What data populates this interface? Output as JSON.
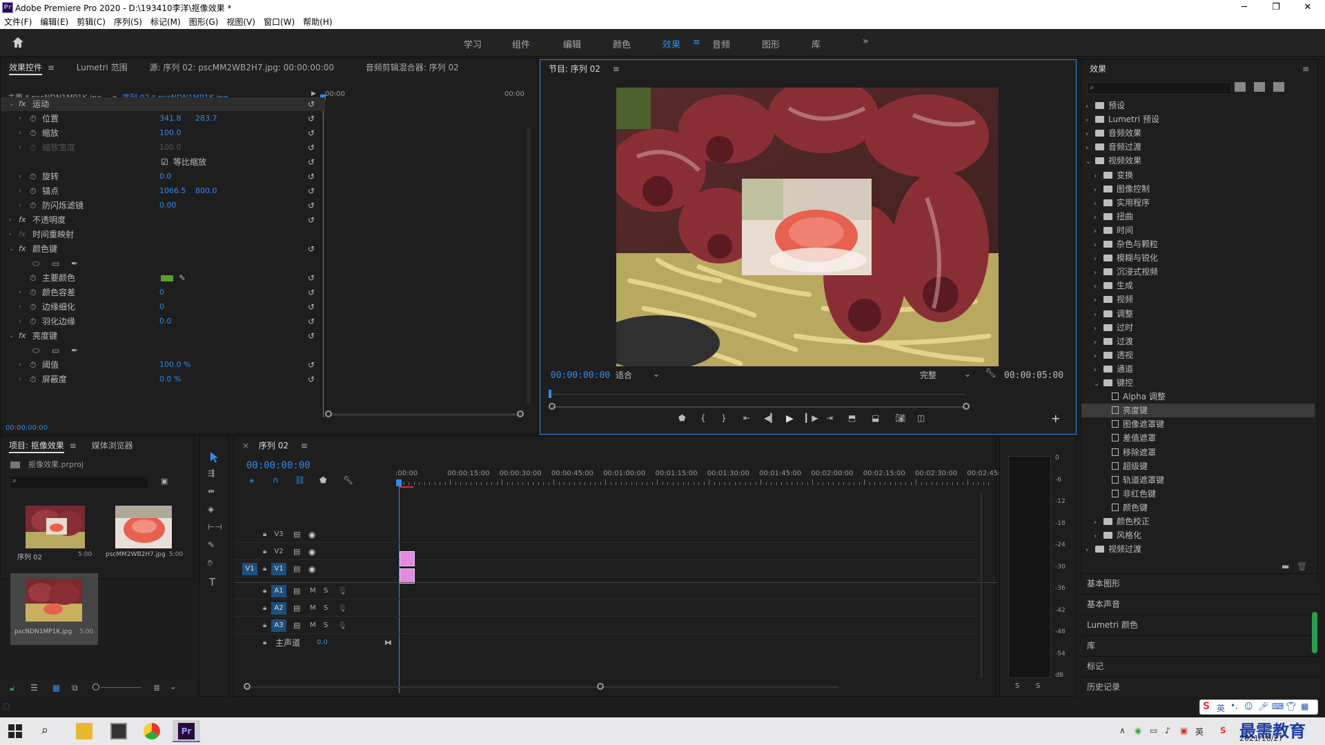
{
  "window": {
    "title": "Adobe Premiere Pro 2020 - D:\\193410李洋\\抠像效果 *",
    "app_icon": "Pr"
  },
  "menu": [
    "文件(F)",
    "编辑(E)",
    "剪辑(C)",
    "序列(S)",
    "标记(M)",
    "图形(G)",
    "视图(V)",
    "窗口(W)",
    "帮助(H)"
  ],
  "workspaces": [
    {
      "label": "学习"
    },
    {
      "label": "组件"
    },
    {
      "label": "编辑"
    },
    {
      "label": "颜色"
    },
    {
      "label": "效果",
      "active": true
    },
    {
      "label": "音频"
    },
    {
      "label": "图形"
    },
    {
      "label": "库"
    }
  ],
  "effect_controls": {
    "tabs": [
      "效果控件",
      "Lumetri 范围",
      "源: 序列 02: pscMM2WB2H7.jpg: 00:00:00:00",
      "音频剪辑混合器: 序列 02"
    ],
    "master": "主要 * pscNDN1MP1K.jpg",
    "sequence_clip": "序列 02 * pscNDN1MP1K.jpg",
    "time_start": "00:00",
    "time_end": "00:00",
    "current_time": "00:00:00:00",
    "rows": [
      {
        "label": "运动",
        "kind": "fx"
      },
      {
        "label": "位置",
        "v1": "341.8",
        "v2": "283.7"
      },
      {
        "label": "缩放",
        "v1": "100.0"
      },
      {
        "label": "缩放宽度",
        "v1": "100.0",
        "dim": true
      },
      {
        "label": "等比缩放",
        "kind": "check"
      },
      {
        "label": "旋转",
        "v1": "0.0"
      },
      {
        "label": "锚点",
        "v1": "1066.5",
        "v2": "800.0"
      },
      {
        "label": "防闪烁滤镜",
        "v1": "0.00"
      },
      {
        "label": "不透明度",
        "kind": "fx"
      },
      {
        "label": "时间重映射",
        "kind": "fx-dim"
      },
      {
        "label": "颜色键",
        "kind": "fx"
      },
      {
        "label": "",
        "kind": "masks"
      },
      {
        "label": "主要颜色",
        "kind": "color"
      },
      {
        "label": "颜色容差",
        "v1": "0"
      },
      {
        "label": "边缘细化",
        "v1": "0"
      },
      {
        "label": "羽化边缘",
        "v1": "0.0"
      },
      {
        "label": "亮度键",
        "kind": "fx"
      },
      {
        "label": "",
        "kind": "masks"
      },
      {
        "label": "阈值",
        "v1": "100.0 %"
      },
      {
        "label": "屏蔽度",
        "v1": "0.0 %"
      }
    ],
    "key_color": "#5aa02c"
  },
  "program": {
    "title": "节目: 序列 02",
    "timecode": "00:00:00:00",
    "fit": "适合",
    "quality": "完整",
    "duration": "00:00:05:00"
  },
  "effects": {
    "title": "效果",
    "items": [
      {
        "label": "预设",
        "level": 0,
        "type": "folder",
        "open": false
      },
      {
        "label": "Lumetri 预设",
        "level": 0,
        "type": "folder",
        "open": false
      },
      {
        "label": "音频效果",
        "level": 0,
        "type": "folder",
        "open": false
      },
      {
        "label": "音频过渡",
        "level": 0,
        "type": "folder",
        "open": false
      },
      {
        "label": "视频效果",
        "level": 0,
        "type": "folder",
        "open": true
      },
      {
        "label": "变换",
        "level": 1,
        "type": "folder",
        "open": false
      },
      {
        "label": "图像控制",
        "level": 1,
        "type": "folder",
        "open": false
      },
      {
        "label": "实用程序",
        "level": 1,
        "type": "folder",
        "open": false
      },
      {
        "label": "扭曲",
        "level": 1,
        "type": "folder",
        "open": false
      },
      {
        "label": "时间",
        "level": 1,
        "type": "folder",
        "open": false
      },
      {
        "label": "杂色与颗粒",
        "level": 1,
        "type": "folder",
        "open": false
      },
      {
        "label": "模糊与锐化",
        "level": 1,
        "type": "folder",
        "open": false
      },
      {
        "label": "沉浸式视频",
        "level": 1,
        "type": "folder",
        "open": false
      },
      {
        "label": "生成",
        "level": 1,
        "type": "folder",
        "open": false
      },
      {
        "label": "视频",
        "level": 1,
        "type": "folder",
        "open": false
      },
      {
        "label": "调整",
        "level": 1,
        "type": "folder",
        "open": false
      },
      {
        "label": "过时",
        "level": 1,
        "type": "folder",
        "open": false
      },
      {
        "label": "过渡",
        "level": 1,
        "type": "folder",
        "open": false
      },
      {
        "label": "透视",
        "level": 1,
        "type": "folder",
        "open": false
      },
      {
        "label": "通道",
        "level": 1,
        "type": "folder",
        "open": false
      },
      {
        "label": "键控",
        "level": 1,
        "type": "folder",
        "open": true
      },
      {
        "label": "Alpha 调整",
        "level": 2,
        "type": "preset"
      },
      {
        "label": "亮度键",
        "level": 2,
        "type": "preset",
        "selected": true
      },
      {
        "label": "图像遮罩键",
        "level": 2,
        "type": "preset"
      },
      {
        "label": "差值遮罩",
        "level": 2,
        "type": "preset"
      },
      {
        "label": "移除遮罩",
        "level": 2,
        "type": "preset"
      },
      {
        "label": "超级键",
        "level": 2,
        "type": "preset"
      },
      {
        "label": "轨道遮罩键",
        "level": 2,
        "type": "preset"
      },
      {
        "label": "非红色键",
        "level": 2,
        "type": "preset"
      },
      {
        "label": "颜色键",
        "level": 2,
        "type": "preset"
      },
      {
        "label": "颜色校正",
        "level": 1,
        "type": "folder",
        "open": false
      },
      {
        "label": "风格化",
        "level": 1,
        "type": "folder",
        "open": false
      },
      {
        "label": "视频过渡",
        "level": 0,
        "type": "folder",
        "open": false
      }
    ],
    "sections": [
      "基本图形",
      "基本声音",
      "Lumetri 颜色",
      "库",
      "标记",
      "历史记录"
    ]
  },
  "project": {
    "tabs": [
      "项目: 抠像效果",
      "媒体浏览器"
    ],
    "file": "抠像效果.prproj",
    "items": [
      {
        "name": "序列 02",
        "dur": "5:00"
      },
      {
        "name": "pscMM2WB2H7.jpg",
        "dur": "5:00"
      },
      {
        "name": "pscNDN1MP1K.jpg",
        "dur": "5:00",
        "selected": true
      }
    ]
  },
  "timeline": {
    "title": "序列 02",
    "timecode": "00:00:00:00",
    "ruler": [
      ":00:00",
      "00:00:15:00",
      "00:00:30:00",
      "00:00:45:00",
      "00:01:00:00",
      "00:01:15:00",
      "00:01:30:00",
      "00:01:45:00",
      "00:02:00:00",
      "00:02:15:00",
      "00:02:30:00",
      "00:02:45:"
    ],
    "video_tracks": [
      "V3",
      "V2",
      "V1"
    ],
    "audio_tracks": [
      "A1",
      "A2",
      "A3"
    ],
    "source_patch": "V1",
    "master": {
      "label": "主声道",
      "value": "0.0"
    },
    "clip_color": "#e08be0"
  },
  "meter": {
    "scale": [
      "0",
      "-6",
      "-12",
      "-18",
      "-24",
      "-30",
      "-36",
      "-42",
      "-48",
      "-54",
      "dB"
    ],
    "solo": [
      "S",
      "S"
    ]
  },
  "taskbar": {
    "date": "2021/10/27",
    "ime": "英",
    "watermark": "最需教育"
  }
}
